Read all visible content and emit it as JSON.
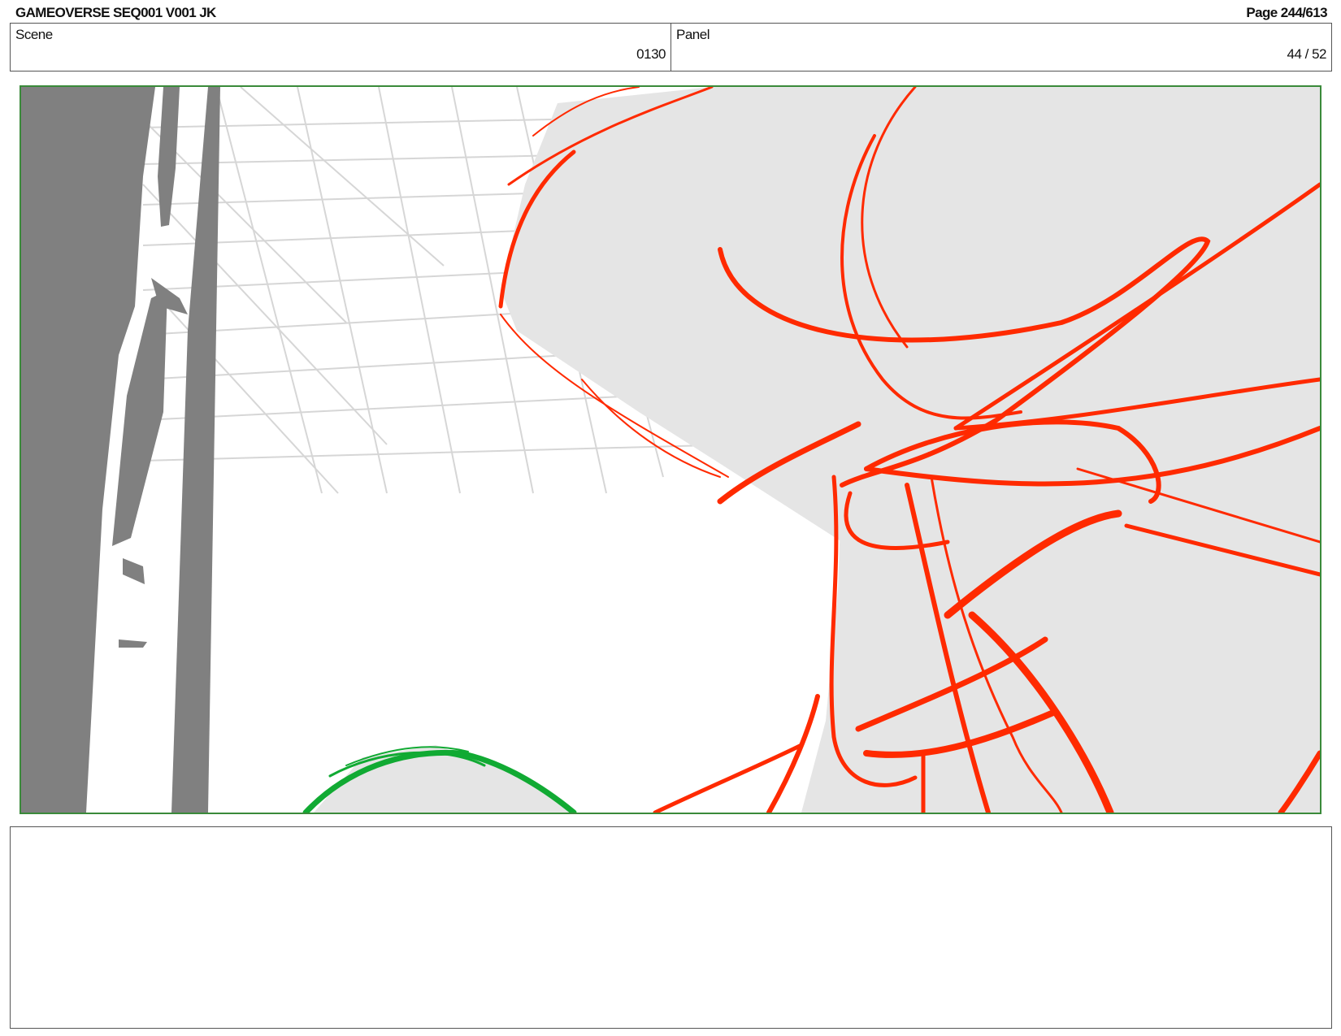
{
  "header": {
    "title": "GAMEOVERSE SEQ001 V001 JK",
    "page": "Page 244/613"
  },
  "info": {
    "scene_label": "Scene",
    "scene_value": "0130",
    "panel_label": "Panel",
    "panel_value": "44 / 52"
  },
  "drawing": {
    "frame_color": "#3a8a3a",
    "sketch_red": "#ff2a00",
    "sketch_green": "#11aa33",
    "fill_gray": "#e5e5e5",
    "column_gray": "#808080",
    "grid_gray": "#d6d6d6"
  },
  "notes": {
    "text": ""
  }
}
